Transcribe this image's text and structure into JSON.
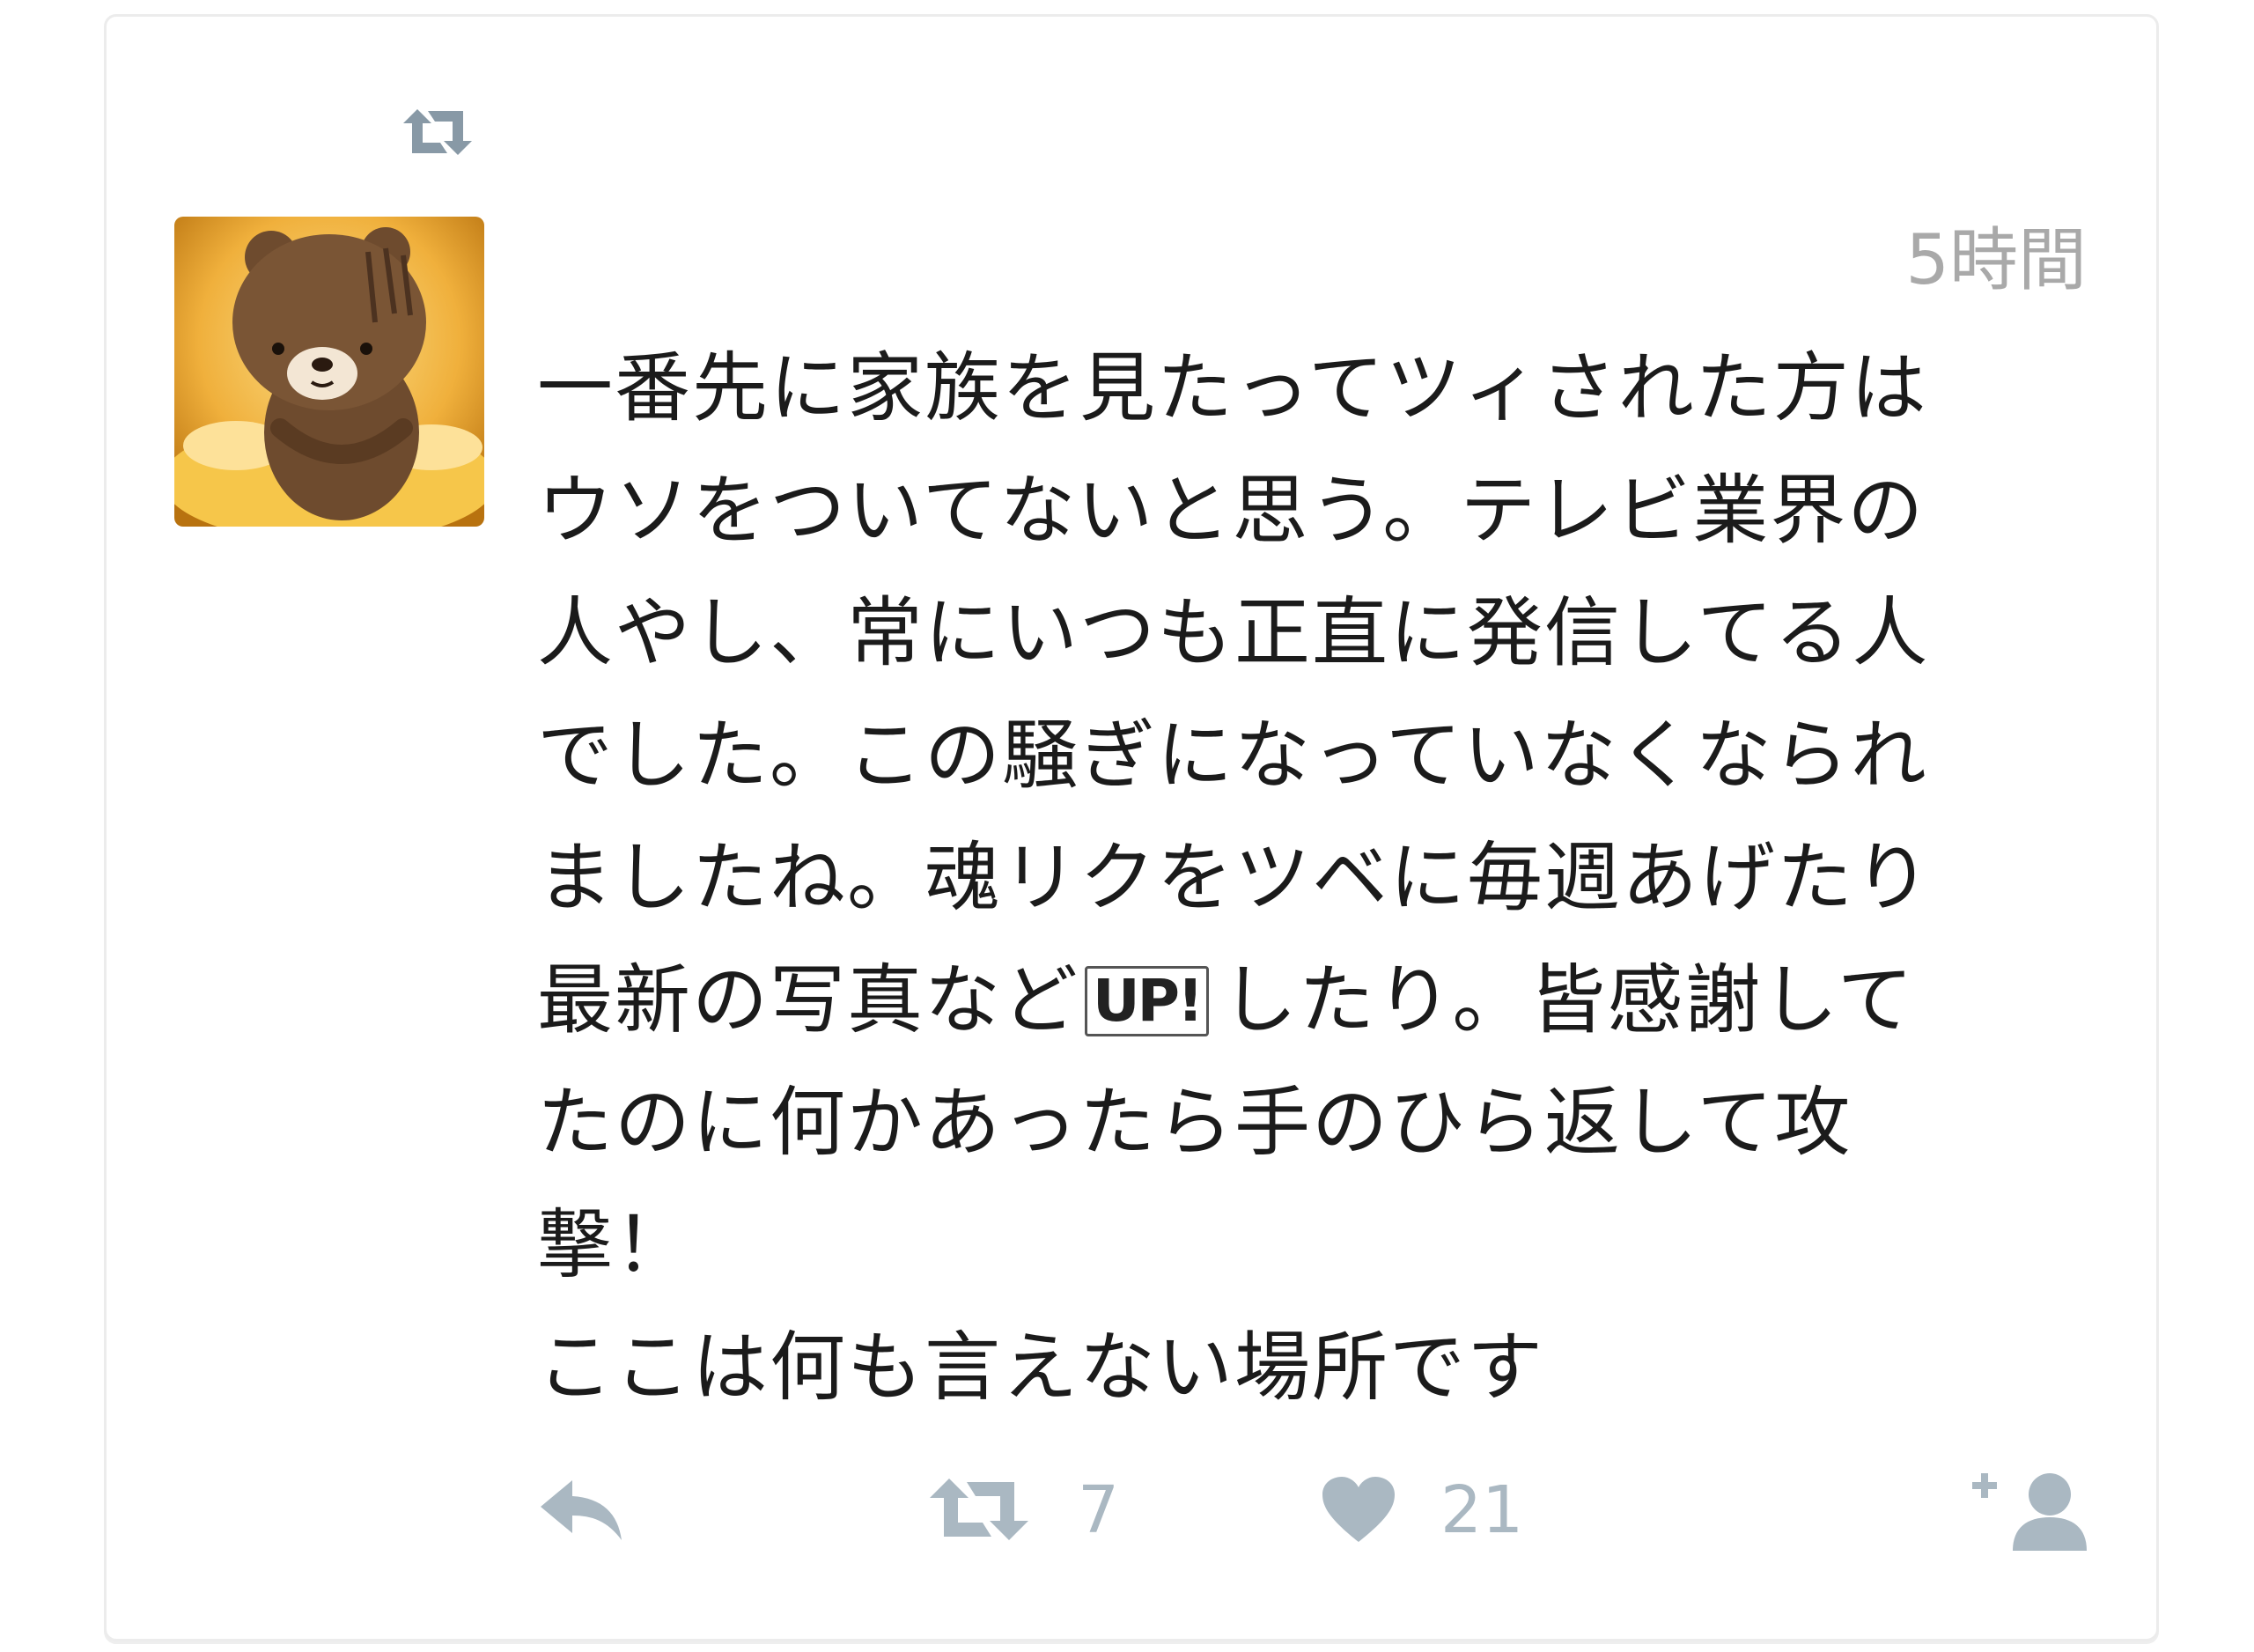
{
  "colors": {
    "icon_gray": "#aab8c2",
    "text": "#1b1b1b",
    "timestamp": "#a9a9a9",
    "border": "#ececec"
  },
  "context": {
    "retweet_icon": "retweet-icon",
    "retweeter_name": ""
  },
  "tweet": {
    "avatar": "avatar",
    "timestamp": "5時間",
    "lines": [
      "一番先に家族を見たってツィされた方は",
      "ウソをついてないと思う。テレビ業界の",
      "人やし、常にいつも正直に発信してる人",
      "でした。この騒ぎになっていなくなられ",
      "ましたね。魂リクをツベに毎週あげたり"
    ],
    "line6_before": "最新の写真など",
    "up_badge": "UP!",
    "line6_after": "したり。皆感謝して",
    "lines_rest": [
      "たのに何かあったら手のひら返して攻",
      "撃！",
      "ここは何も言えない場所です"
    ]
  },
  "actions": {
    "reply_icon": "reply-icon",
    "retweet_icon": "retweet-icon",
    "retweet_count": "7",
    "like_icon": "heart-icon",
    "like_count": "21",
    "follow_icon": "follow-icon"
  }
}
